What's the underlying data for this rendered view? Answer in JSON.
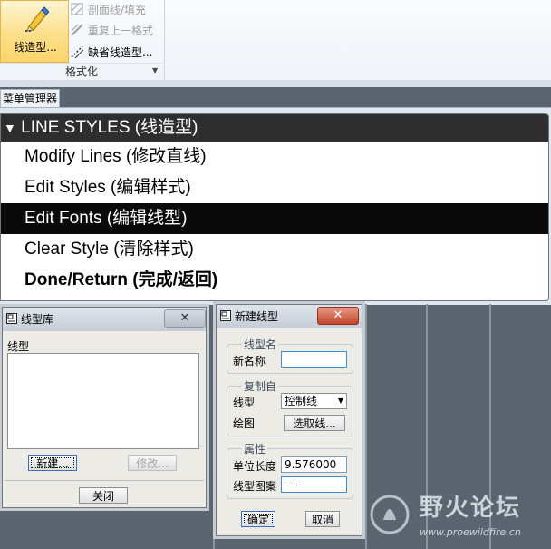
{
  "ribbon": {
    "big_button_label": "线造型...",
    "items": [
      {
        "label": "剖面线/填充",
        "icon": "hatch-icon",
        "disabled": true
      },
      {
        "label": "重复上一格式",
        "icon": "repeat-format-icon",
        "disabled": true
      },
      {
        "label": "缺省线造型...",
        "icon": "default-line-style-icon",
        "disabled": false
      }
    ],
    "group_label": "格式化"
  },
  "menu_manager": {
    "title": "菜单管理器",
    "header": "LINE STYLES (线造型)",
    "items": [
      {
        "label": "Modify Lines (修改直线)"
      },
      {
        "label": "Edit Styles (编辑样式)"
      },
      {
        "label": "Edit Fonts (编辑线型)",
        "selected": true
      },
      {
        "label": "Clear Style (清除样式)"
      },
      {
        "label": "Done/Return (完成/返回)",
        "bold": true
      }
    ]
  },
  "line_library_dialog": {
    "title": "线型库",
    "close_symbol": "✕",
    "list_label": "线型",
    "new_button": "新建...",
    "modify_button": "修改...",
    "close_button": "关闭"
  },
  "new_line_style_dialog": {
    "title": "新建线型",
    "close_symbol": "✕",
    "group_name": "线型名",
    "new_name_label": "新名称",
    "new_name_value": "",
    "group_copy": "复制自",
    "line_type_label": "线型",
    "line_type_value": "控制线",
    "drawing_label": "绘图",
    "select_line_button": "选取线...",
    "group_props": "属性",
    "unit_length_label": "单位长度",
    "unit_length_value": "9.576000",
    "pattern_label": "线型图案",
    "pattern_value": "- ---",
    "ok_button": "确定",
    "cancel_button": "取消"
  },
  "watermark": {
    "text": "野火论坛",
    "url": "www.proewildfire.cn"
  }
}
